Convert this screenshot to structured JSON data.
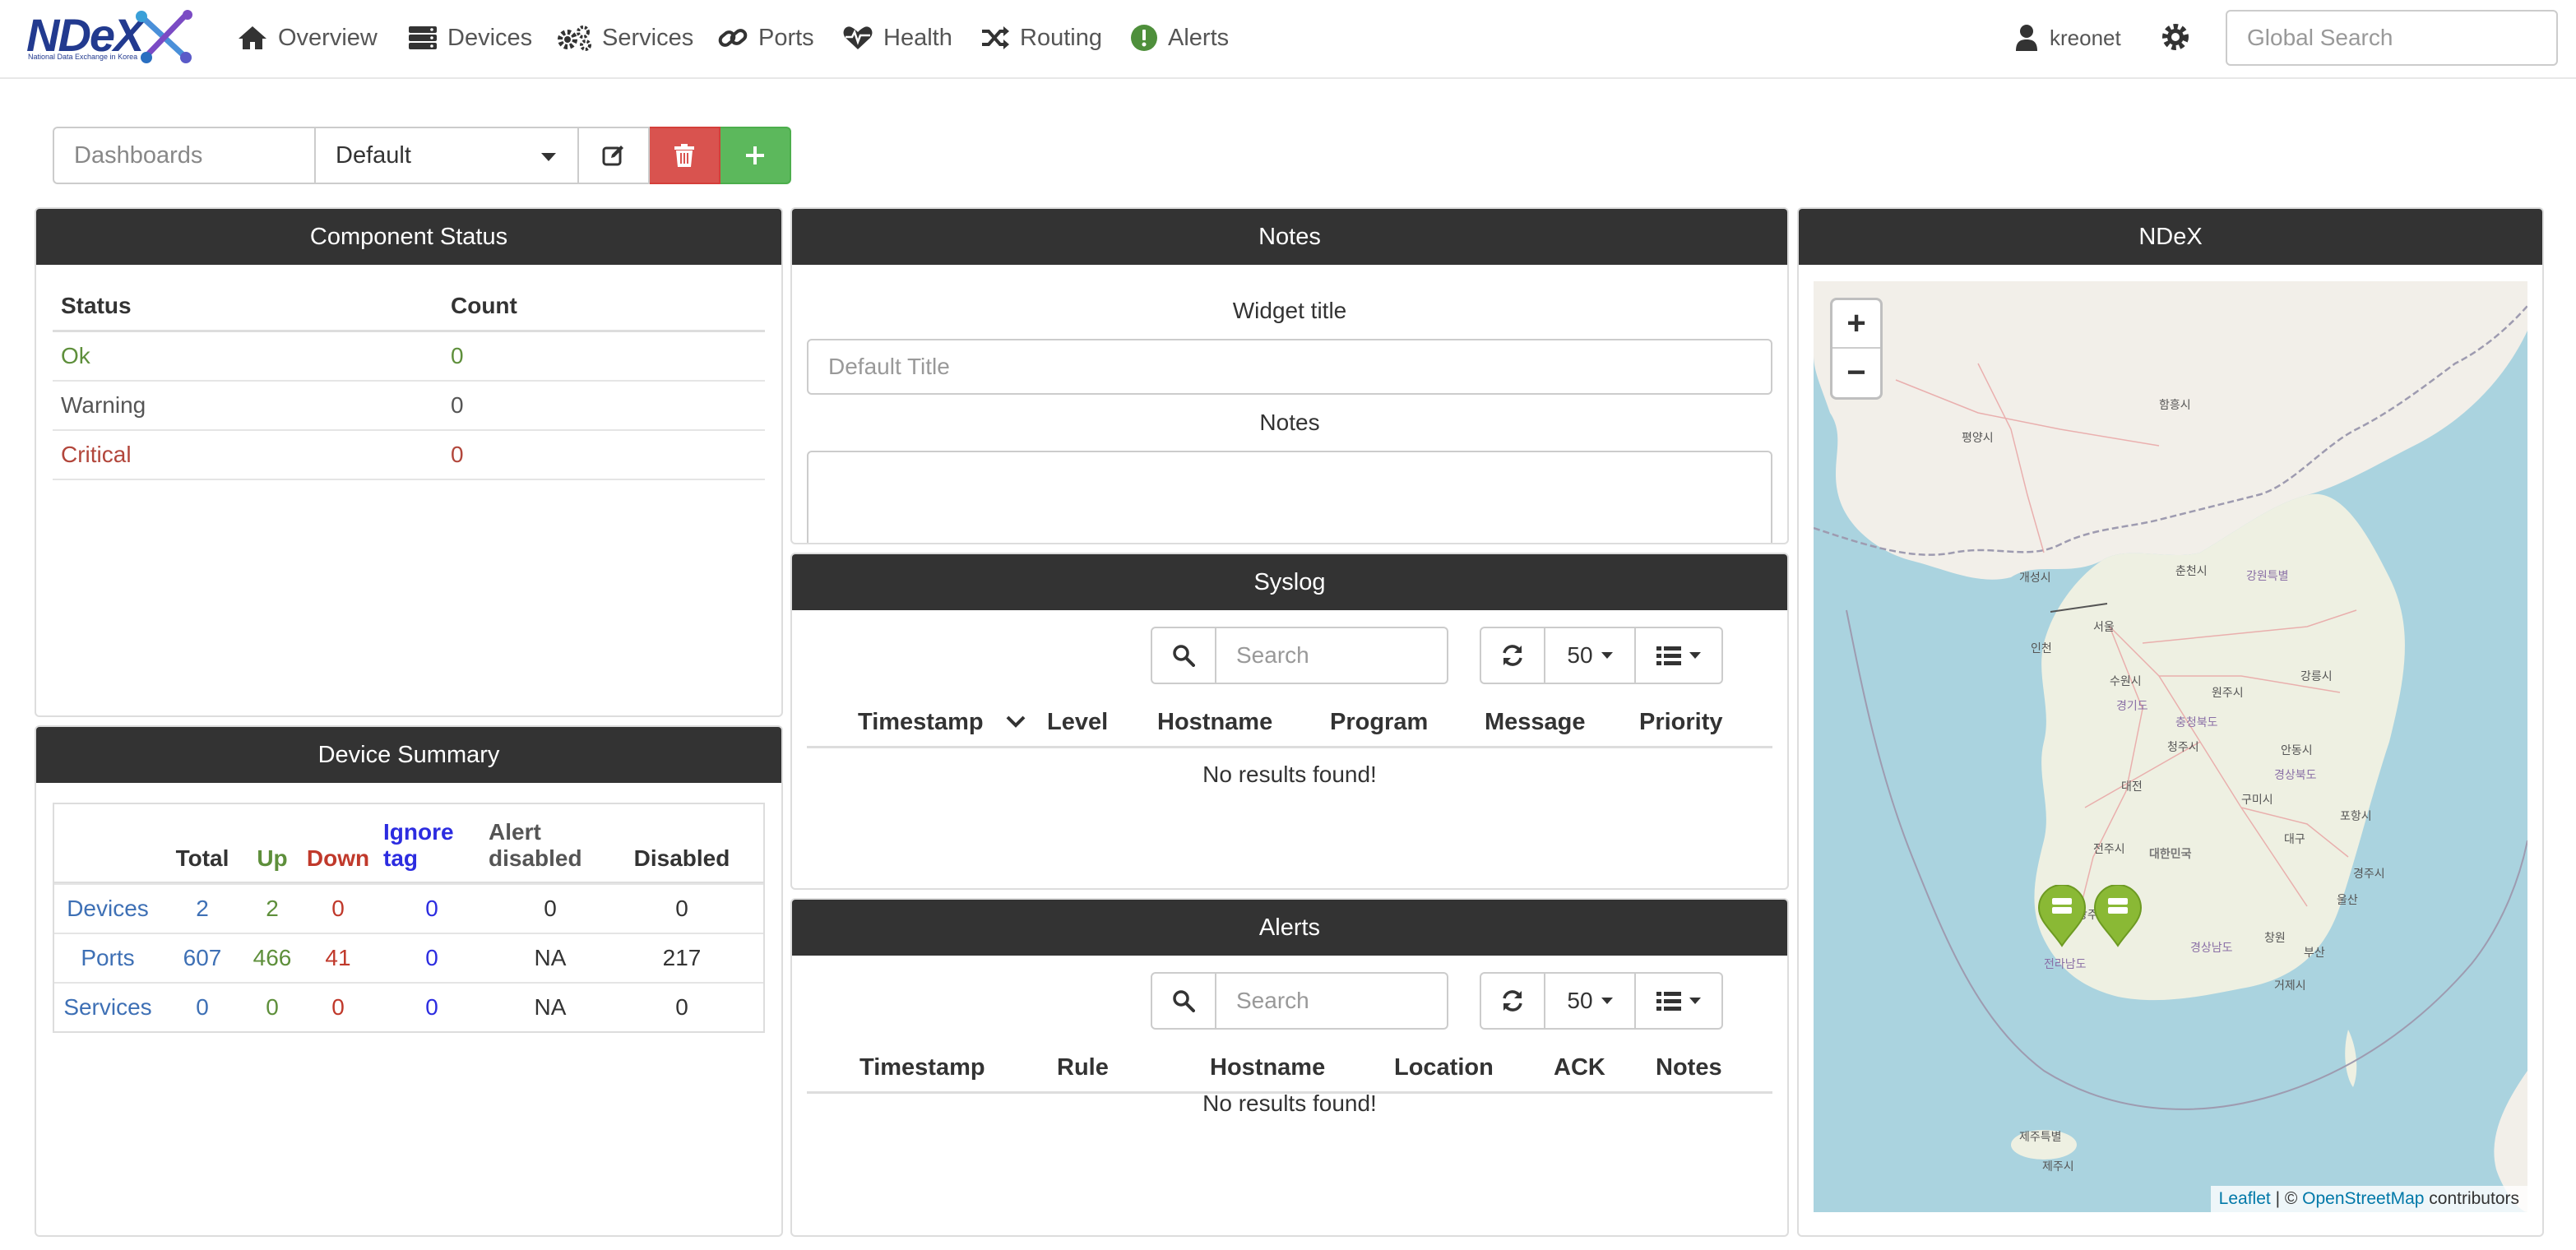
{
  "nav": {
    "logo": "NDeX",
    "logo_sub": "National Data Exchange in Korea",
    "items": [
      {
        "label": "Overview",
        "icon": "home-icon"
      },
      {
        "label": "Devices",
        "icon": "server-icon"
      },
      {
        "label": "Services",
        "icon": "cogs-icon"
      },
      {
        "label": "Ports",
        "icon": "link-icon"
      },
      {
        "label": "Health",
        "icon": "heartbeat-icon"
      },
      {
        "label": "Routing",
        "icon": "random-icon"
      },
      {
        "label": "Alerts",
        "icon": "exclamation-circle-icon"
      }
    ],
    "user": "kreonet",
    "search_placeholder": "Global Search"
  },
  "dashboard": {
    "label": "Dashboards",
    "selected": "Default"
  },
  "component_status": {
    "title": "Component Status",
    "headers": [
      "Status",
      "Count"
    ],
    "rows": [
      {
        "status": "Ok",
        "count": "0"
      },
      {
        "status": "Warning",
        "count": "0"
      },
      {
        "status": "Critical",
        "count": "0"
      }
    ]
  },
  "device_summary": {
    "title": "Device Summary",
    "headers": {
      "total": "Total",
      "up": "Up",
      "down": "Down",
      "ignore": "Ignore tag",
      "alert_disabled": "Alert disabled",
      "disabled": "Disabled"
    },
    "rows": [
      {
        "name": "Devices",
        "total": "2",
        "up": "2",
        "down": "0",
        "ignore": "0",
        "alert_disabled": "0",
        "disabled": "0"
      },
      {
        "name": "Ports",
        "total": "607",
        "up": "466",
        "down": "41",
        "ignore": "0",
        "alert_disabled": "NA",
        "disabled": "217"
      },
      {
        "name": "Services",
        "total": "0",
        "up": "0",
        "down": "0",
        "ignore": "0",
        "alert_disabled": "NA",
        "disabled": "0"
      }
    ]
  },
  "notes": {
    "title": "Notes",
    "widget_title_label": "Widget title",
    "widget_title_placeholder": "Default Title",
    "notes_label": "Notes"
  },
  "syslog": {
    "title": "Syslog",
    "search_placeholder": "Search",
    "page_size": "50",
    "columns": [
      "Timestamp",
      "Level",
      "Hostname",
      "Program",
      "Message",
      "Priority"
    ],
    "empty": "No results found!"
  },
  "alerts": {
    "title": "Alerts",
    "search_placeholder": "Search",
    "page_size": "50",
    "columns": [
      "Timestamp",
      "Rule",
      "Hostname",
      "Location",
      "ACK",
      "Notes"
    ],
    "empty": "No results found!"
  },
  "map": {
    "title": "NDeX",
    "zoom_in": "+",
    "zoom_out": "−",
    "attrib_leaflet": "Leaflet",
    "attrib_sep": " | © ",
    "attrib_osm": "OpenStreetMap",
    "attrib_tail": " contributors",
    "labels": [
      "서울",
      "인천",
      "수원시",
      "대전",
      "대구",
      "울산",
      "부산",
      "광주",
      "전주시",
      "창원",
      "포항시",
      "강릉시",
      "춘천시",
      "원주시",
      "청주시",
      "안동시",
      "구미시",
      "경주시",
      "제주특별",
      "평양시",
      "함흥시",
      "개성시",
      "대한민국",
      "경기도",
      "강원특별",
      "충청북도",
      "경상북도",
      "전라남도",
      "경상남도",
      "거제시",
      "제주시"
    ],
    "marker_color": "#8ab935"
  }
}
